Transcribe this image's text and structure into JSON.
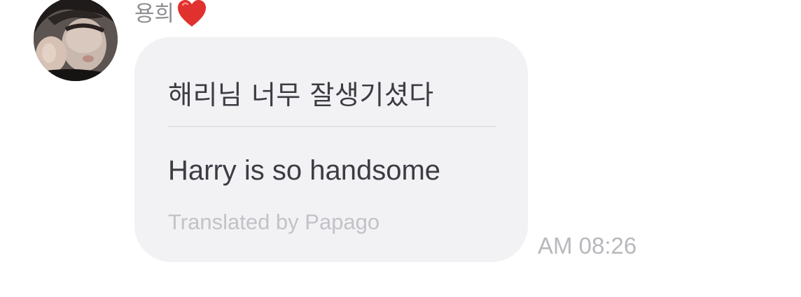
{
  "message": {
    "sender_name": "용희",
    "sender_emoji_icon": "heart-icon",
    "original_text": "해리님 너무 잘생기셨다",
    "translated_text": "Harry is so handsome",
    "translation_credit": "Translated by Papago",
    "timestamp": "AM 08:26"
  },
  "colors": {
    "bubble_background": "#f2f2f5",
    "message_text": "#3c3c43",
    "secondary_text": "#8e8e93",
    "credit_text": "#c2c2c7",
    "timestamp_text": "#b8b8bd",
    "heart": "#e0312e"
  }
}
